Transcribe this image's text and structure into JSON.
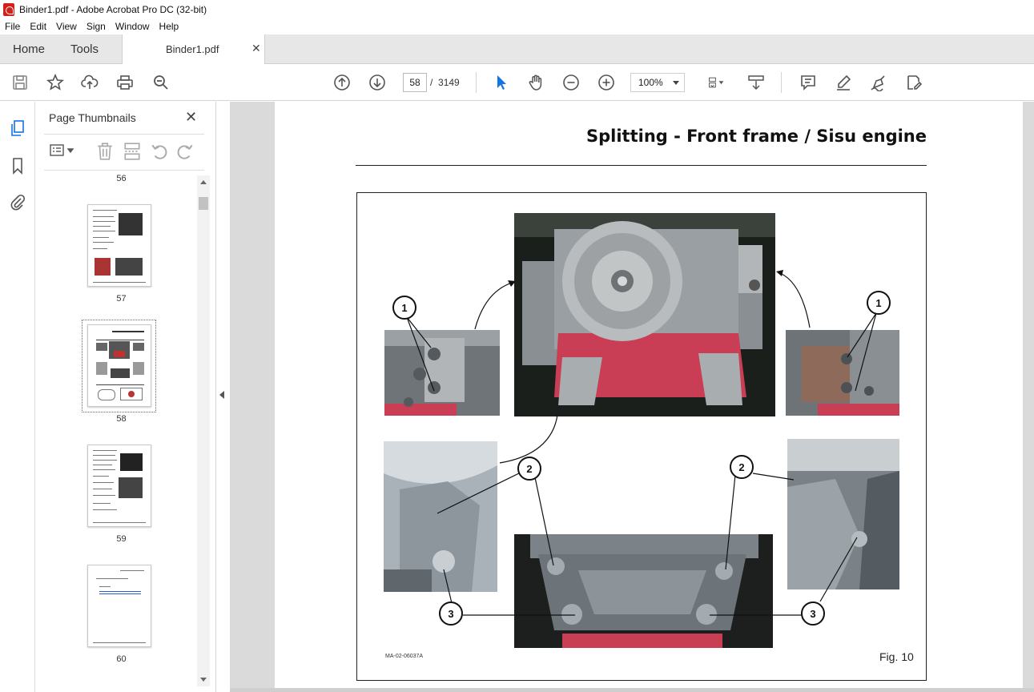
{
  "window": {
    "title": "Binder1.pdf - Adobe Acrobat Pro DC (32-bit)"
  },
  "menu": [
    "File",
    "Edit",
    "View",
    "Sign",
    "Window",
    "Help"
  ],
  "tabs": {
    "home": "Home",
    "tools": "Tools",
    "document": "Binder1.pdf"
  },
  "toolbar": {
    "current_page": "58",
    "page_separator": "/",
    "total_pages": "3149",
    "zoom": "100%"
  },
  "thumbnails_panel": {
    "title": "Page Thumbnails",
    "pages": [
      {
        "label": "56"
      },
      {
        "label": "57"
      },
      {
        "label": "58",
        "selected": true
      },
      {
        "label": "59"
      },
      {
        "label": "60"
      }
    ]
  },
  "document": {
    "heading": "Splitting - Front frame / Sisu engine",
    "figure_caption": "Fig. 10",
    "figure_code": "MA-02-06037A",
    "callouts": [
      "1",
      "1",
      "2",
      "2",
      "3",
      "3"
    ]
  },
  "colors": {
    "accent_blue": "#1473e6",
    "acrobat_red": "#d4201b",
    "engine_red": "#c93d55"
  }
}
